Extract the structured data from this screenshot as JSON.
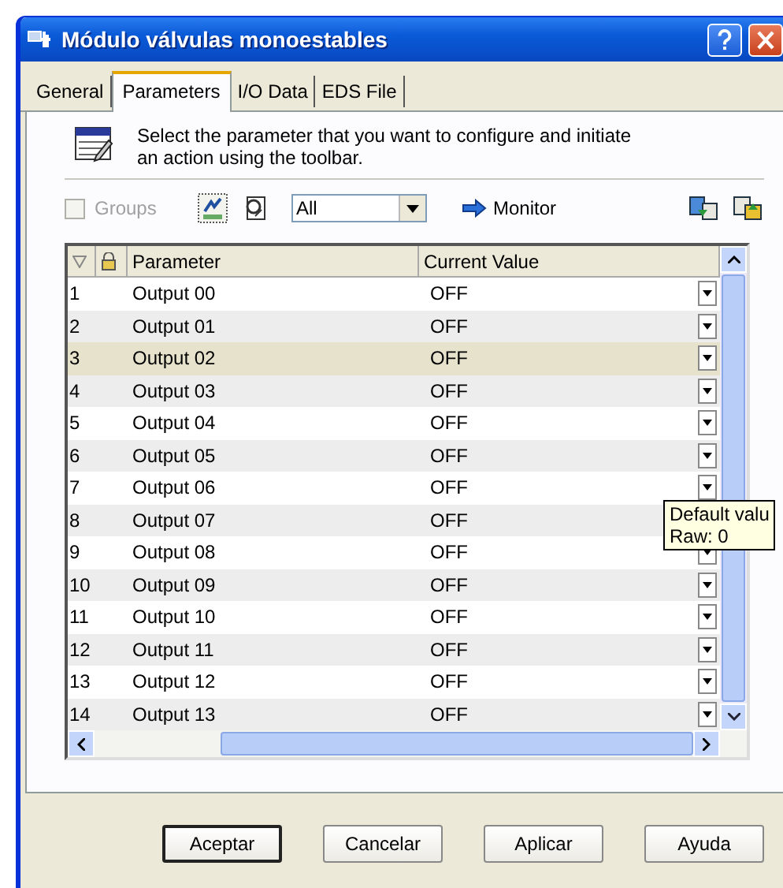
{
  "window": {
    "title": "Módulo válvulas monoestables"
  },
  "tabs": [
    {
      "label": "General",
      "selected": false
    },
    {
      "label": "Parameters",
      "selected": true
    },
    {
      "label": "I/O Data",
      "selected": false
    },
    {
      "label": "EDS File",
      "selected": false
    }
  ],
  "instruction": "Select the parameter that you want to configure and initiate an action using the toolbar.",
  "toolbar": {
    "groups": {
      "label": "Groups",
      "checked": false,
      "disabled": true
    },
    "filter": {
      "value": "All"
    },
    "monitor": "Monitor"
  },
  "table": {
    "columns": [
      "Parameter",
      "Current Value"
    ],
    "rows": [
      {
        "number": "1",
        "parameter": "Output 00",
        "value": "OFF",
        "selected": false
      },
      {
        "number": "2",
        "parameter": "Output 01",
        "value": "OFF",
        "selected": false
      },
      {
        "number": "3",
        "parameter": "Output 02",
        "value": "OFF",
        "selected": true
      },
      {
        "number": "4",
        "parameter": "Output 03",
        "value": "OFF",
        "selected": false
      },
      {
        "number": "5",
        "parameter": "Output 04",
        "value": "OFF",
        "selected": false
      },
      {
        "number": "6",
        "parameter": "Output 05",
        "value": "OFF",
        "selected": false
      },
      {
        "number": "7",
        "parameter": "Output 06",
        "value": "OFF",
        "selected": false
      },
      {
        "number": "8",
        "parameter": "Output 07",
        "value": "OFF",
        "selected": false,
        "dropdown": false
      },
      {
        "number": "9",
        "parameter": "Output 08",
        "value": "OFF",
        "selected": false
      },
      {
        "number": "10",
        "parameter": "Output 09",
        "value": "OFF",
        "selected": false
      },
      {
        "number": "11",
        "parameter": "Output 10",
        "value": "OFF",
        "selected": false
      },
      {
        "number": "12",
        "parameter": "Output 11",
        "value": "OFF",
        "selected": false
      },
      {
        "number": "13",
        "parameter": "Output 12",
        "value": "OFF",
        "selected": false
      },
      {
        "number": "14",
        "parameter": "Output 13",
        "value": "OFF",
        "selected": false
      }
    ]
  },
  "tooltip": [
    "Default valu",
    "Raw: 0"
  ],
  "buttons": [
    {
      "label": "Aceptar",
      "default": true
    },
    {
      "label": "Cancelar",
      "default": false
    },
    {
      "label": "Aplicar",
      "default": false
    },
    {
      "label": "Ayuda",
      "default": false
    }
  ]
}
